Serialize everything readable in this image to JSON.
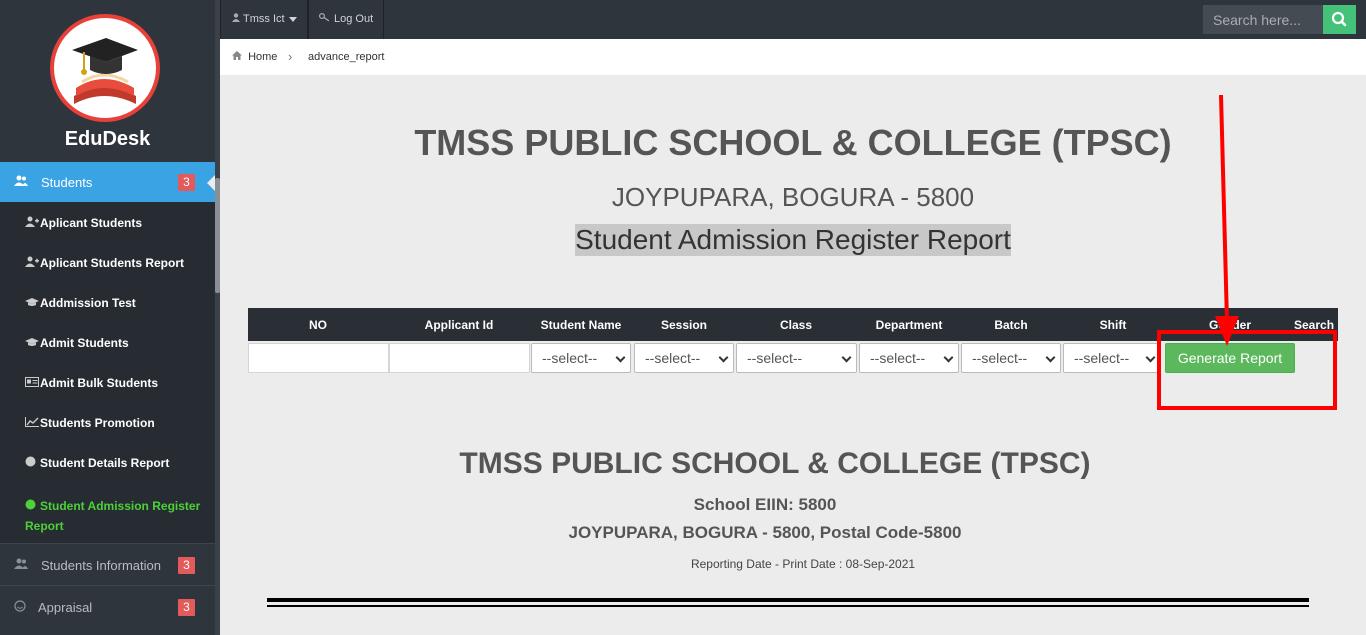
{
  "app": {
    "name": "EduDesk"
  },
  "topbar": {
    "user_label": "Tmss Ict",
    "logout_label": "Log Out",
    "search_placeholder": "Search here..."
  },
  "breadcrumb": {
    "home": "Home",
    "current": "advance_report"
  },
  "sidebar": {
    "active": {
      "label": "Students",
      "badge": "3"
    },
    "submenu": [
      {
        "label": "Aplicant Students",
        "icon": "user-plus-icon"
      },
      {
        "label": "Aplicant Students Report",
        "icon": "user-plus-icon"
      },
      {
        "label": "Addmission Test",
        "icon": "graduation-cap-icon"
      },
      {
        "label": "Admit Students",
        "icon": "graduation-cap-icon"
      },
      {
        "label": "Admit Bulk Students",
        "icon": "id-card-icon"
      },
      {
        "label": "Students Promotion",
        "icon": "chart-line-icon"
      },
      {
        "label": "Student Details Report",
        "icon": "circle-icon"
      },
      {
        "label": "Student Admission Register",
        "label2": "Report",
        "icon": "circle-icon"
      }
    ],
    "items": [
      {
        "label": "Students Information",
        "badge": "3"
      },
      {
        "label": "Appraisal",
        "badge": "3"
      }
    ]
  },
  "header": {
    "school": "TMSS PUBLIC SCHOOL & COLLEGE (TPSC)",
    "address": "JOYPUPARA, BOGURA - 5800",
    "report_title": "Student Admission Register Report"
  },
  "filter": {
    "columns": [
      "NO",
      "Applicant Id",
      "Student Name",
      "Session",
      "Class",
      "Department",
      "Batch",
      "Shift",
      "Gender",
      "Search"
    ],
    "select_placeholder": "--select--",
    "generate_label": "Generate Report"
  },
  "report": {
    "school": "TMSS PUBLIC SCHOOL & COLLEGE (TPSC)",
    "eiin": "School EIIN: 5800",
    "address": "JOYPUPARA, BOGURA - 5800, Postal Code-5800",
    "date_line": "Reporting Date - Print Date : 08-Sep-2021"
  },
  "colors": {
    "accent": "#3aa3e3",
    "badge": "#e35a5a",
    "active_sub": "#4cd137",
    "generate": "#5cb85c",
    "annotation": "#ff0000"
  }
}
